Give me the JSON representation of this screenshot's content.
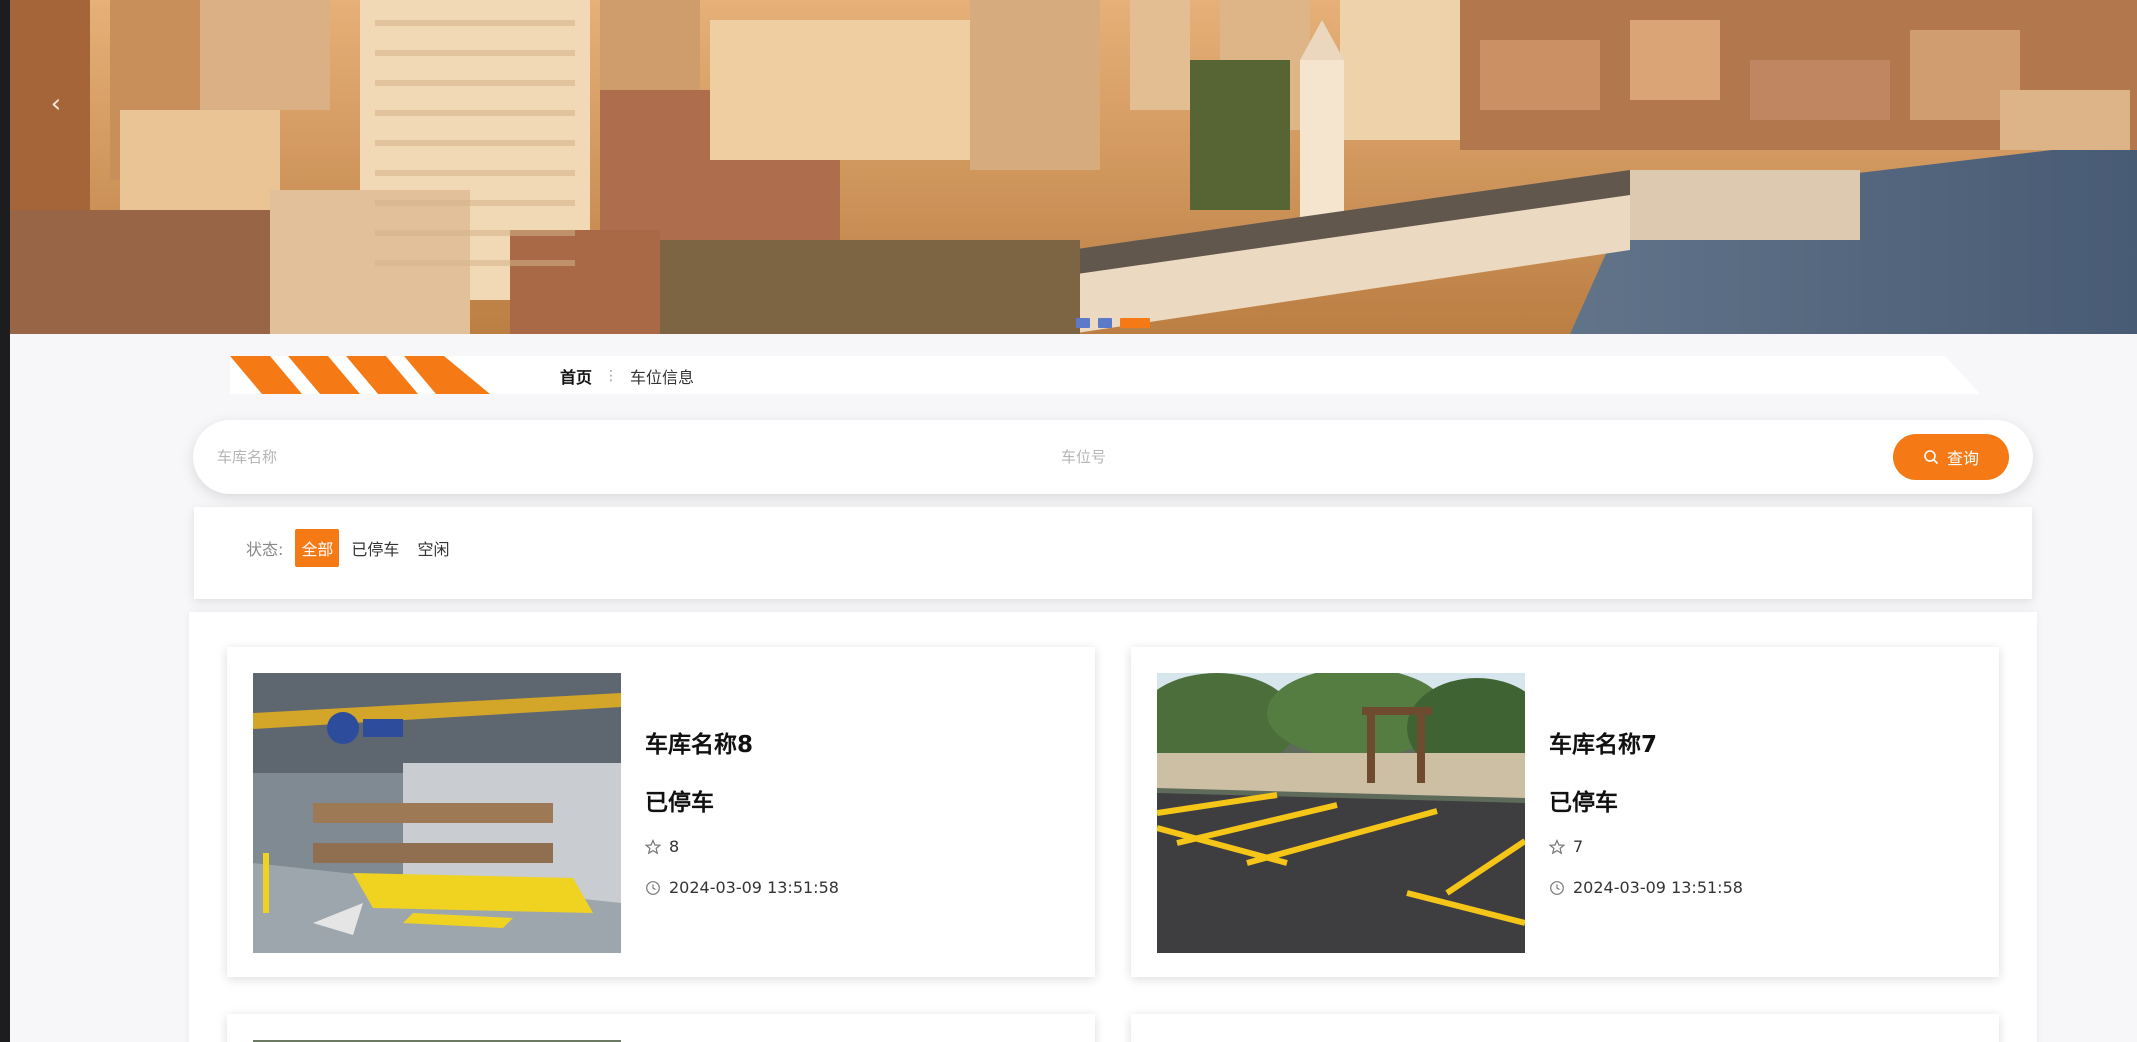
{
  "banner": {
    "prev_label": "‹",
    "slide_count": 3,
    "active_slide": 3
  },
  "breadcrumb": {
    "home": "首页",
    "separator": "⋮",
    "current": "车位信息"
  },
  "search": {
    "garage_placeholder": "车库名称",
    "slot_placeholder": "车位号",
    "button_label": "查询"
  },
  "filter": {
    "label": "状态:",
    "options": [
      "全部",
      "已停车",
      "空闲"
    ],
    "selected": "全部"
  },
  "cards": [
    {
      "name": "车库名称8",
      "status": "已停车",
      "number": "8",
      "time": "2024-03-09 13:51:58"
    },
    {
      "name": "车库名称7",
      "status": "已停车",
      "number": "7",
      "time": "2024-03-09 13:51:58"
    }
  ],
  "icons": {
    "star": "star-icon",
    "clock": "clock-icon",
    "search": "search-icon"
  },
  "colors": {
    "accent": "#f57a16",
    "indicator": "#5c7ac8"
  }
}
